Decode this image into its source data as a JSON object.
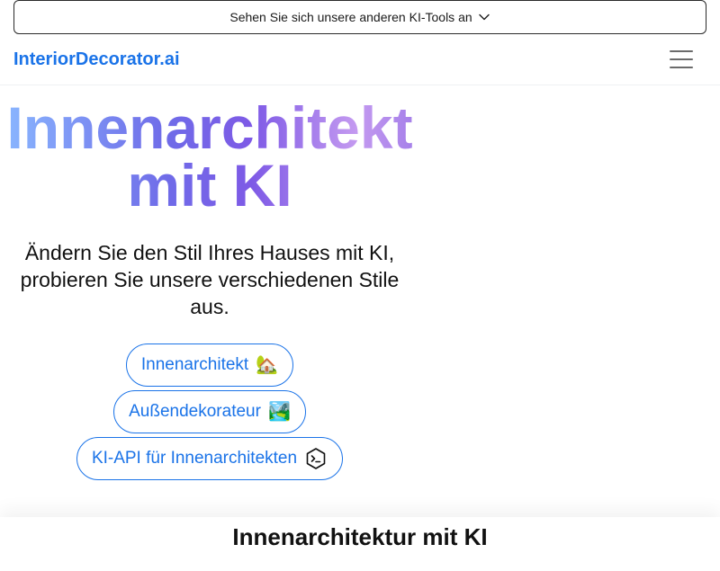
{
  "banner": {
    "label": "Sehen Sie sich unsere anderen KI-Tools an",
    "icon": "chevron-down-icon"
  },
  "navbar": {
    "brand": "InteriorDecorator.ai",
    "menu_icon": "hamburger-menu-icon"
  },
  "hero": {
    "title_line1": "Innenarchitekt",
    "title_line2": "mit KI",
    "subtitle": "Ändern Sie den Stil Ihres Hauses mit KI, probieren Sie unsere verschiedenen Stile aus.",
    "buttons": [
      {
        "label": "Innenarchitekt",
        "emoji": "🏡"
      },
      {
        "label": "Außendekorateur",
        "emoji": "🏞️"
      },
      {
        "label": "KI-API für Innenarchitekten",
        "icon": "terminal-icon"
      }
    ]
  },
  "section": {
    "heading": "Innenarchitektur mit KI"
  },
  "colors": {
    "brand": "#1a73e8",
    "gradient_start": "#8ab8ff",
    "gradient_mid": "#6f6be8",
    "gradient_end": "#c49af0"
  }
}
